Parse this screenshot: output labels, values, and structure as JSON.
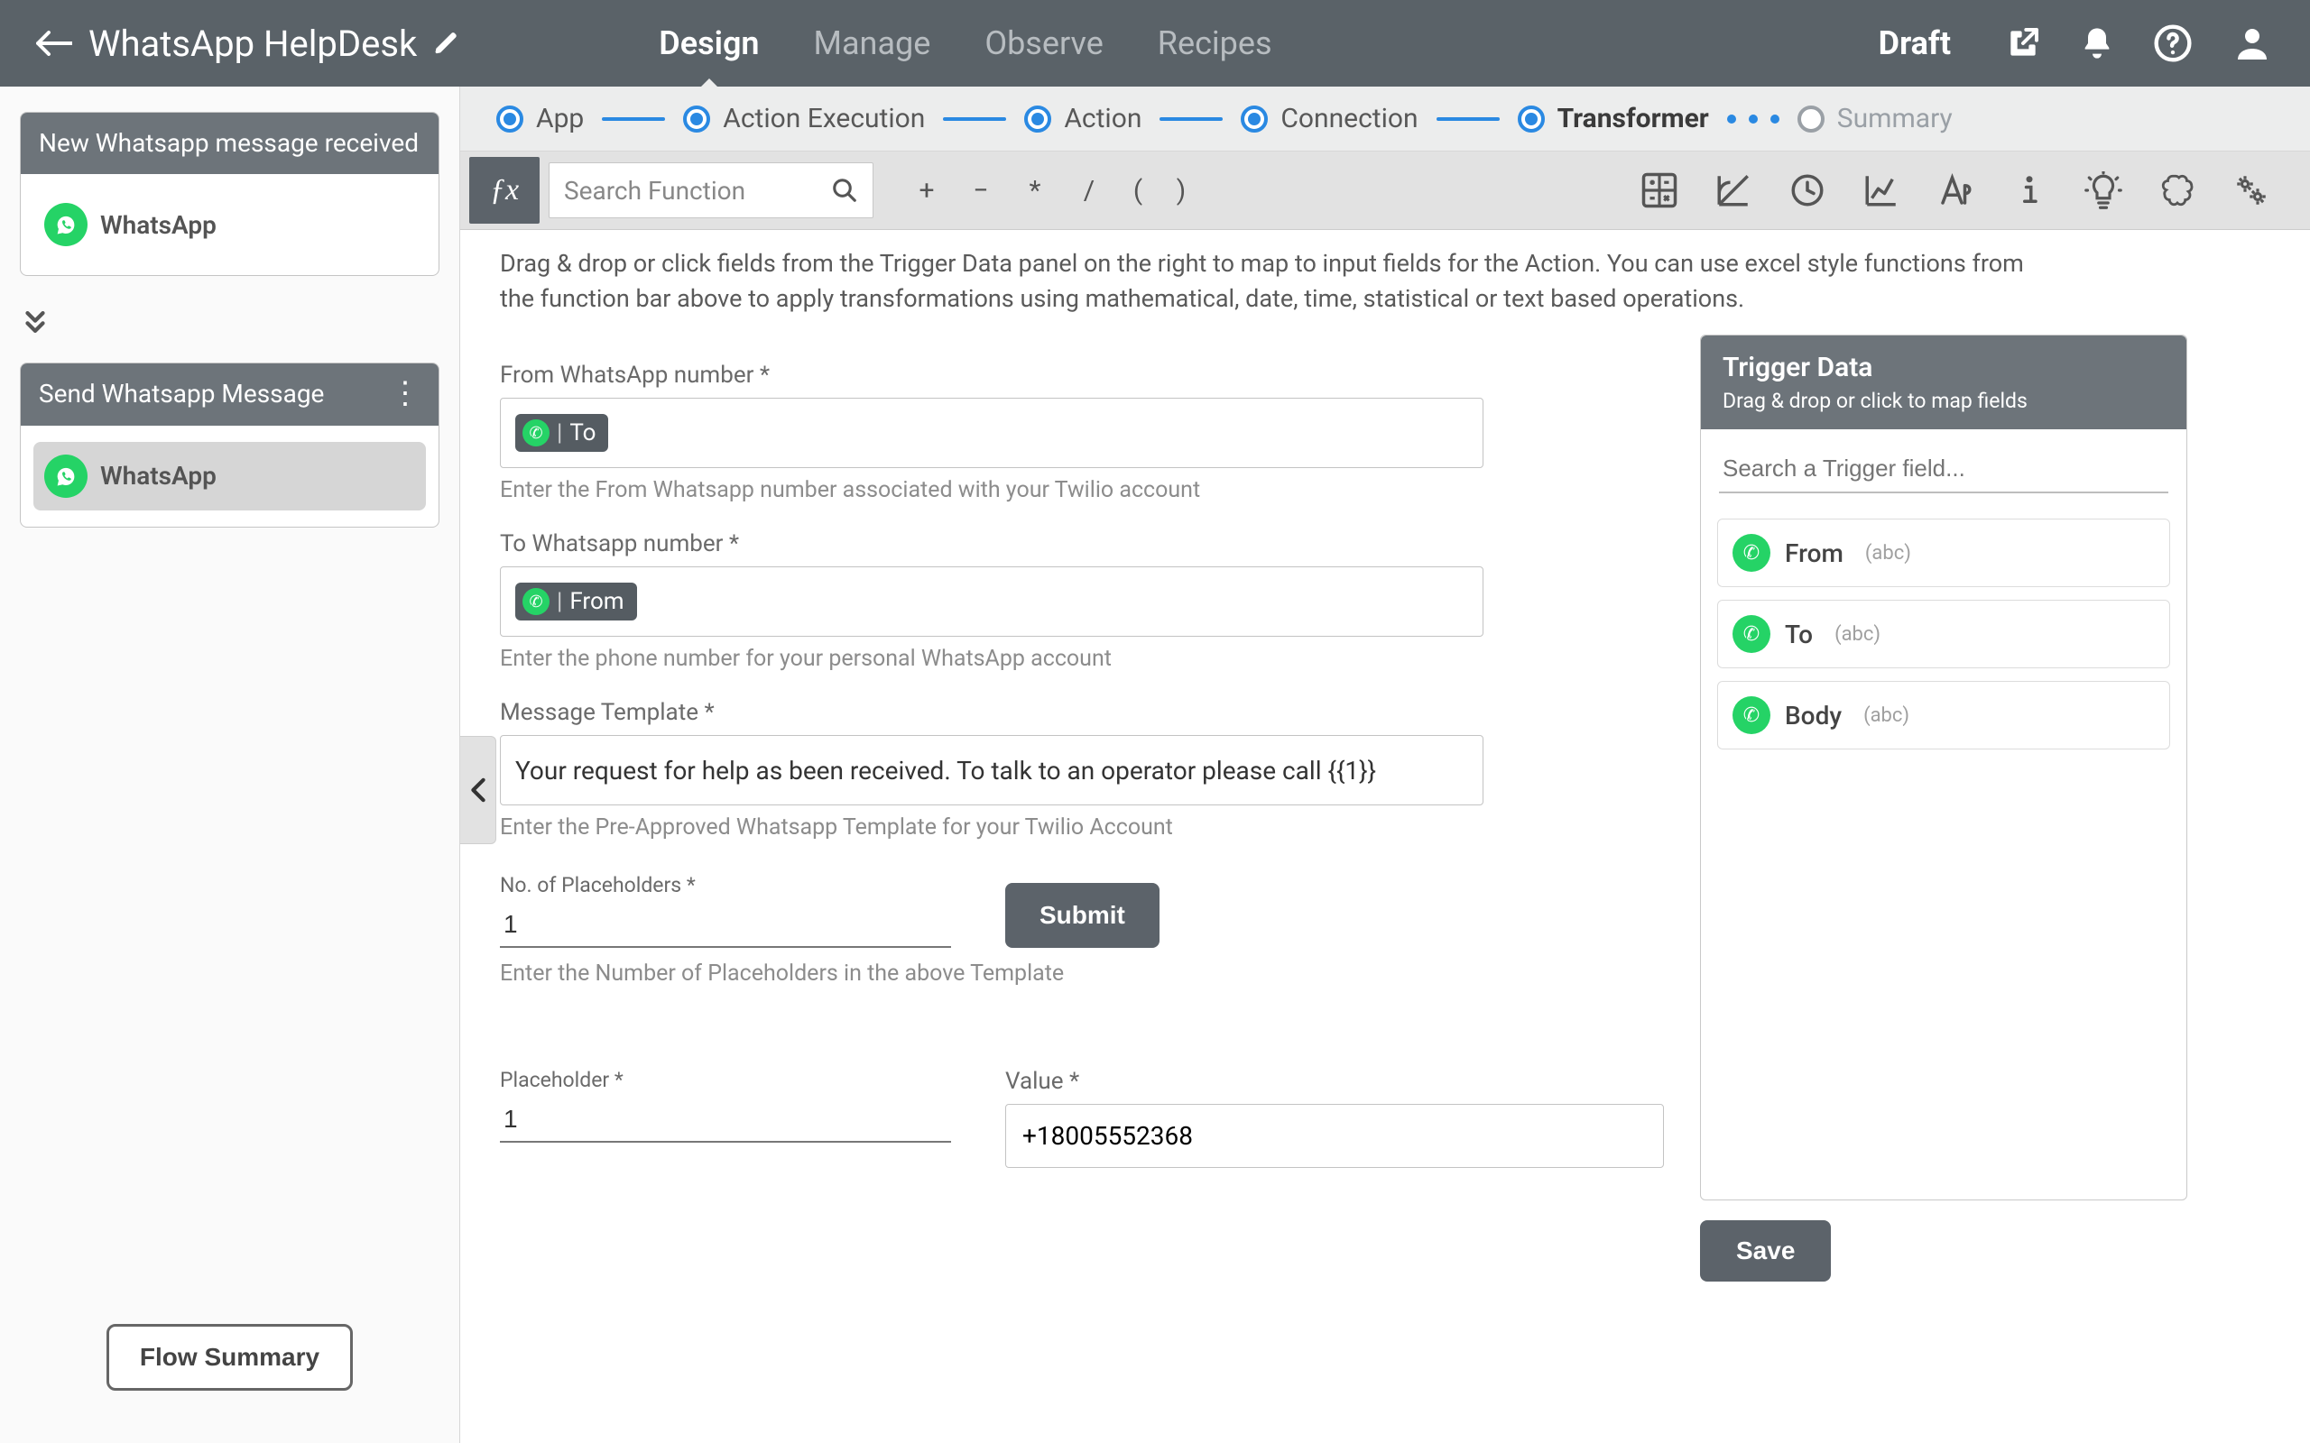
{
  "header": {
    "title": "WhatsApp HelpDesk",
    "status": "Draft",
    "nav": [
      "Design",
      "Manage",
      "Observe",
      "Recipes"
    ],
    "active_nav": "Design"
  },
  "sidebar": {
    "trigger_card": {
      "title": "New Whatsapp message received",
      "app": "WhatsApp"
    },
    "action_card": {
      "title": "Send Whatsapp Message",
      "app": "WhatsApp"
    },
    "flow_summary_label": "Flow Summary"
  },
  "steps": {
    "items": [
      "App",
      "Action Execution",
      "Action",
      "Connection",
      "Transformer",
      "Summary"
    ],
    "active": "Transformer"
  },
  "fnbar": {
    "search_placeholder": "Search Function",
    "operators": [
      "+",
      "−",
      "*",
      "/",
      "(",
      ")"
    ]
  },
  "description": "Drag & drop or click fields from the Trigger Data panel on the right to map to input fields for the Action. You can use excel style functions from the function bar above to apply transformations using mathematical, date, time, statistical or text based operations.",
  "form": {
    "from": {
      "label": "From WhatsApp number *",
      "chip": "To",
      "hint": "Enter the From Whatsapp number associated with your Twilio account"
    },
    "to": {
      "label": "To Whatsapp number *",
      "chip": "From",
      "hint": "Enter the phone number for your personal WhatsApp account"
    },
    "template": {
      "label": "Message Template *",
      "value": "Your request for help as been received. To talk to an operator please call {{1}}",
      "hint": "Enter the Pre-Approved Whatsapp Template for your Twilio Account"
    },
    "placeholders": {
      "count_label": "No. of Placeholders *",
      "count_value": "1",
      "count_hint": "Enter the Number of Placeholders in the above Template",
      "submit_label": "Submit",
      "ph_label": "Placeholder *",
      "ph_value": "1",
      "val_label": "Value *",
      "val_value": "+18005552368"
    }
  },
  "trigger_panel": {
    "title": "Trigger Data",
    "subtitle": "Drag & drop or click to map fields",
    "search_placeholder": "Search a Trigger field...",
    "fields": [
      {
        "name": "From",
        "type": "(abc)"
      },
      {
        "name": "To",
        "type": "(abc)"
      },
      {
        "name": "Body",
        "type": "(abc)"
      }
    ],
    "save_label": "Save"
  }
}
